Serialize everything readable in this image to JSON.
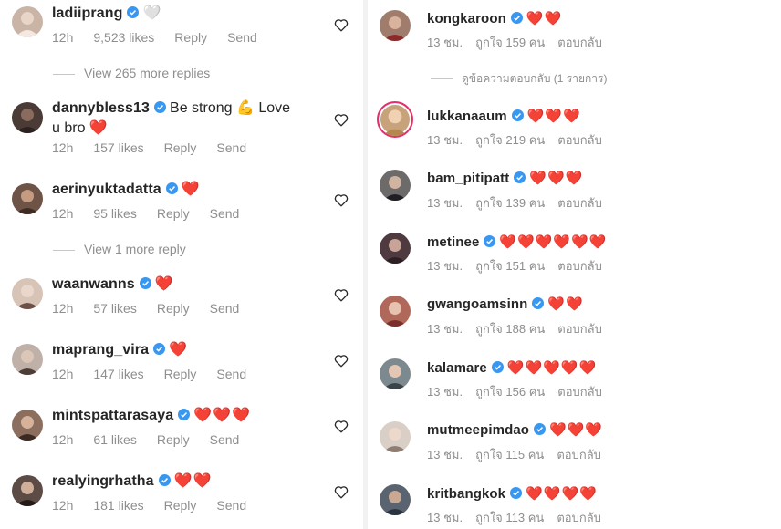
{
  "left": {
    "comments": [
      {
        "username": "ladiiprang",
        "text": "",
        "emoji": "🤍",
        "time": "12h",
        "likes": "9,523 likes",
        "reply": "Reply",
        "send": "Send",
        "avatar_color": "#c9b4a6"
      },
      {
        "username": "dannybless13",
        "text": "Be strong 💪 Love u bro ❤️",
        "emoji": "",
        "time": "12h",
        "likes": "157 likes",
        "reply": "Reply",
        "send": "Send",
        "avatar_color": "#4a3b36"
      },
      {
        "username": "aerinyuktadatta",
        "text": "",
        "emoji": "❤️",
        "time": "12h",
        "likes": "95 likes",
        "reply": "Reply",
        "send": "Send",
        "avatar_color": "#6e5446"
      },
      {
        "username": "waanwanns",
        "text": "",
        "emoji": "❤️",
        "time": "12h",
        "likes": "57 likes",
        "reply": "Reply",
        "send": "Send",
        "avatar_color": "#d8c3b7"
      },
      {
        "username": "maprang_vira",
        "text": "",
        "emoji": "❤️",
        "time": "12h",
        "likes": "147 likes",
        "reply": "Reply",
        "send": "Send",
        "avatar_color": "#bfb1a8"
      },
      {
        "username": "mintspattarasaya",
        "text": "",
        "emoji": "❤️❤️❤️",
        "time": "12h",
        "likes": "61 likes",
        "reply": "Reply",
        "send": "Send",
        "avatar_color": "#8b6e5e"
      },
      {
        "username": "realyingrhatha",
        "text": "",
        "emoji": "❤️❤️",
        "time": "12h",
        "likes": "181 likes",
        "reply": "Reply",
        "send": "Send",
        "avatar_color": "#5d4b45"
      }
    ],
    "view_more_1": "View 265 more replies",
    "view_more_2": "View 1 more reply"
  },
  "right": {
    "comments": [
      {
        "username": "kongkaroon",
        "emoji": "❤️❤️",
        "time": "13 ชม.",
        "likes": "ถูกใจ 159 คน",
        "reply": "ตอบกลับ",
        "avatar_color": "#a07c6c"
      },
      {
        "username": "lukkanaaum",
        "emoji": "❤️❤️❤️",
        "time": "13 ชม.",
        "likes": "ถูกใจ 219 คน",
        "reply": "ตอบกลับ",
        "avatar_color": "#c8a27a"
      },
      {
        "username": "bam_pitipatt",
        "emoji": "❤️❤️❤️",
        "time": "13 ชม.",
        "likes": "ถูกใจ 139 คน",
        "reply": "ตอบกลับ",
        "avatar_color": "#6d6a6a"
      },
      {
        "username": "metinee",
        "emoji": "❤️❤️❤️❤️❤️❤️",
        "time": "13 ชม.",
        "likes": "ถูกใจ 151 คน",
        "reply": "ตอบกลับ",
        "avatar_color": "#4f3a40"
      },
      {
        "username": "gwangoamsinn",
        "emoji": "❤️❤️",
        "time": "13 ชม.",
        "likes": "ถูกใจ 188 คน",
        "reply": "ตอบกลับ",
        "avatar_color": "#b0685a"
      },
      {
        "username": "kalamare",
        "emoji": "❤️❤️❤️❤️❤️",
        "time": "13 ชม.",
        "likes": "ถูกใจ 156 คน",
        "reply": "ตอบกลับ",
        "avatar_color": "#7c8a8f"
      },
      {
        "username": "mutmeepimdao",
        "emoji": "❤️❤️❤️",
        "time": "13 ชม.",
        "likes": "ถูกใจ 115 คน",
        "reply": "ตอบกลับ",
        "avatar_color": "#d9cfc6"
      },
      {
        "username": "kritbangkok",
        "emoji": "❤️❤️❤️❤️",
        "time": "13 ชม.",
        "likes": "ถูกใจ 113 คน",
        "reply": "ตอบกลับ",
        "avatar_color": "#5a6470"
      }
    ],
    "view_more": "ดูข้อความตอบกลับ (1 รายการ)"
  },
  "colors": {
    "verified": "#3897f0",
    "heart": "#e0202f",
    "meta": "#8e8e8e",
    "username": "#262626"
  }
}
